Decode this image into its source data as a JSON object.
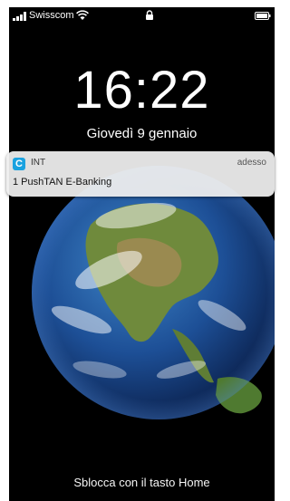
{
  "statusbar": {
    "carrier": "Swisscom",
    "signal_icon": "signal-bars-icon",
    "wifi_icon": "wifi-icon",
    "lock_icon": "lock-icon",
    "battery_icon": "battery-icon"
  },
  "lockscreen": {
    "time": "16:22",
    "date": "Giovedì 9 gennaio",
    "unlock_hint": "Sblocca con il tasto Home"
  },
  "notification": {
    "app_icon_letter": "C",
    "app_icon_color": "#1aa2e0",
    "app_name": "INT",
    "time": "adesso",
    "body": "1 PushTAN E-Banking"
  }
}
